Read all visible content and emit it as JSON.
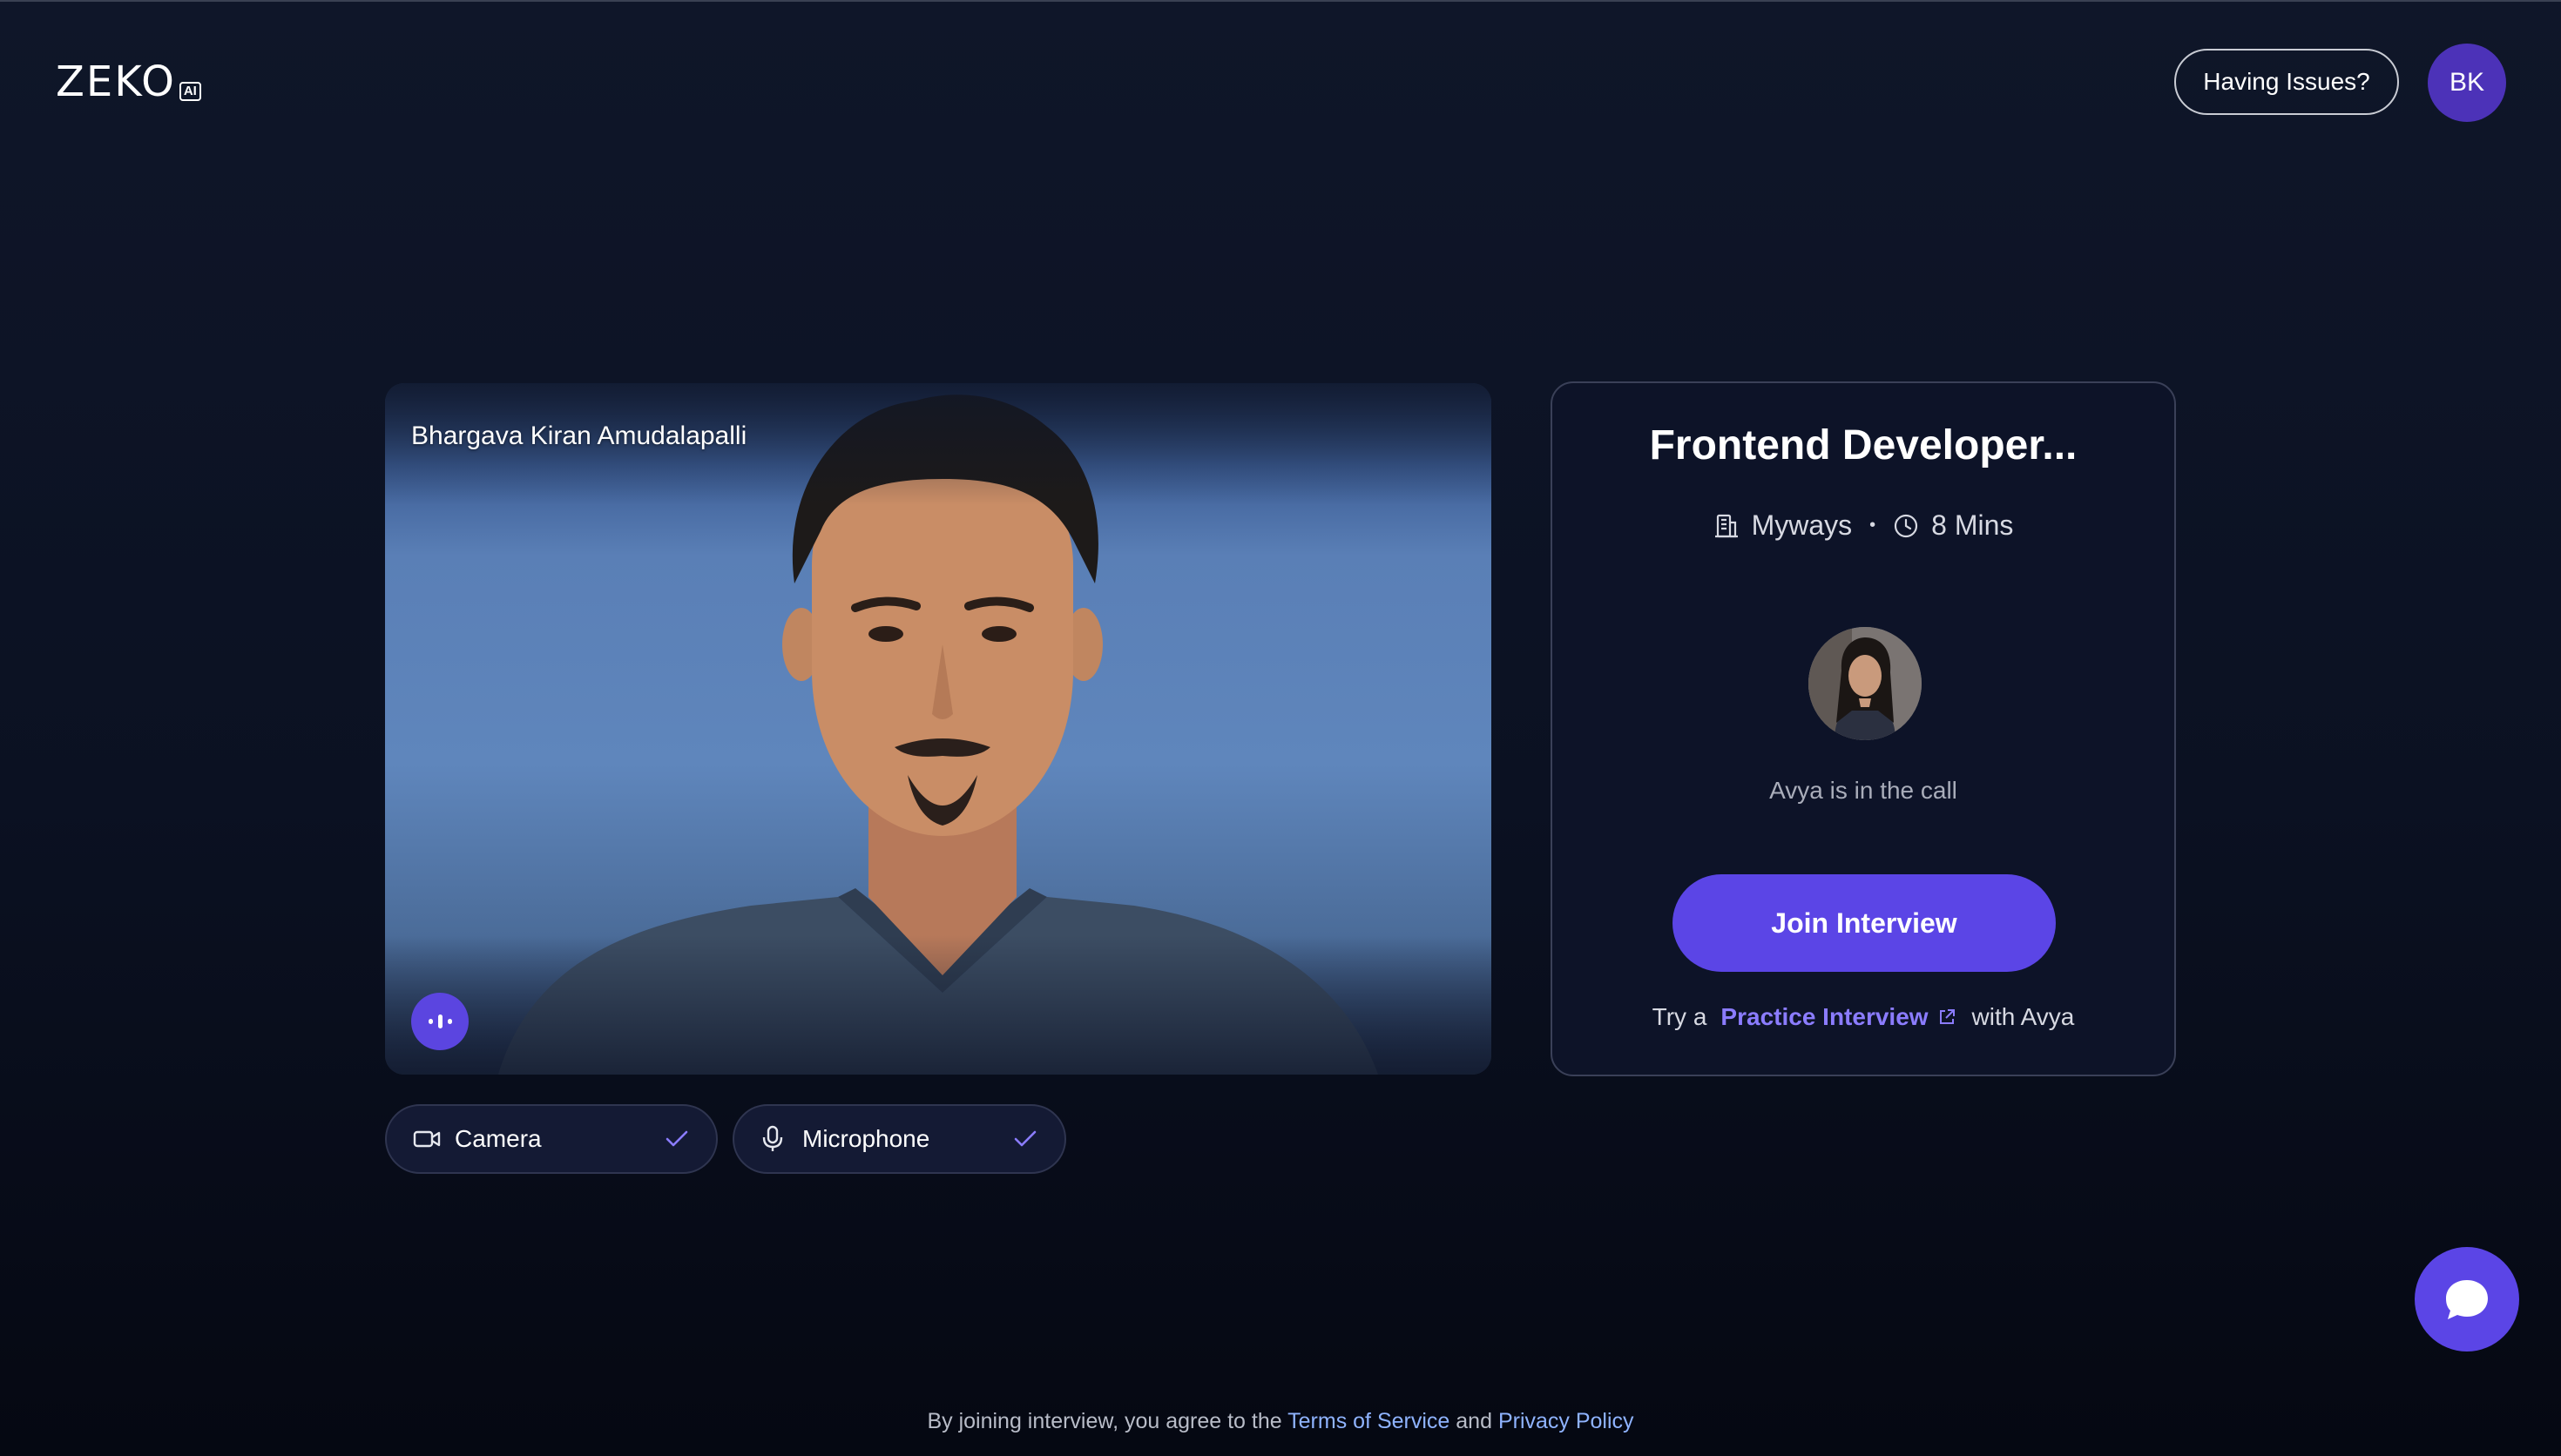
{
  "header": {
    "logo_text": "ZEKO",
    "logo_badge": "AI",
    "issues_button": "Having Issues?",
    "user_initials": "BK"
  },
  "video": {
    "participant_name": "Bhargava Kiran Amudalapalli"
  },
  "devices": {
    "camera_label": "Camera",
    "microphone_label": "Microphone"
  },
  "interview": {
    "title": "Frontend Developer...",
    "company": "Myways",
    "duration": "8 Mins",
    "status_text": "Avya is in the call",
    "join_button": "Join Interview",
    "practice_prefix": "Try a",
    "practice_link": "Practice Interview",
    "practice_suffix": "with Avya"
  },
  "footer": {
    "prefix": "By joining interview, you agree to the",
    "terms_link": "Terms of Service",
    "conjunction": "and",
    "privacy_link": "Privacy Policy"
  },
  "icons": {
    "company": "building-icon",
    "duration": "clock-icon",
    "camera": "video-camera-icon",
    "microphone": "microphone-icon",
    "check": "check-icon",
    "external": "external-link-icon",
    "chat": "chat-bubble-icon"
  },
  "colors": {
    "accent": "#5b45e6",
    "link": "#8b7cff",
    "footer_link": "#8fb3ff",
    "avatar": "#4c32b8"
  }
}
